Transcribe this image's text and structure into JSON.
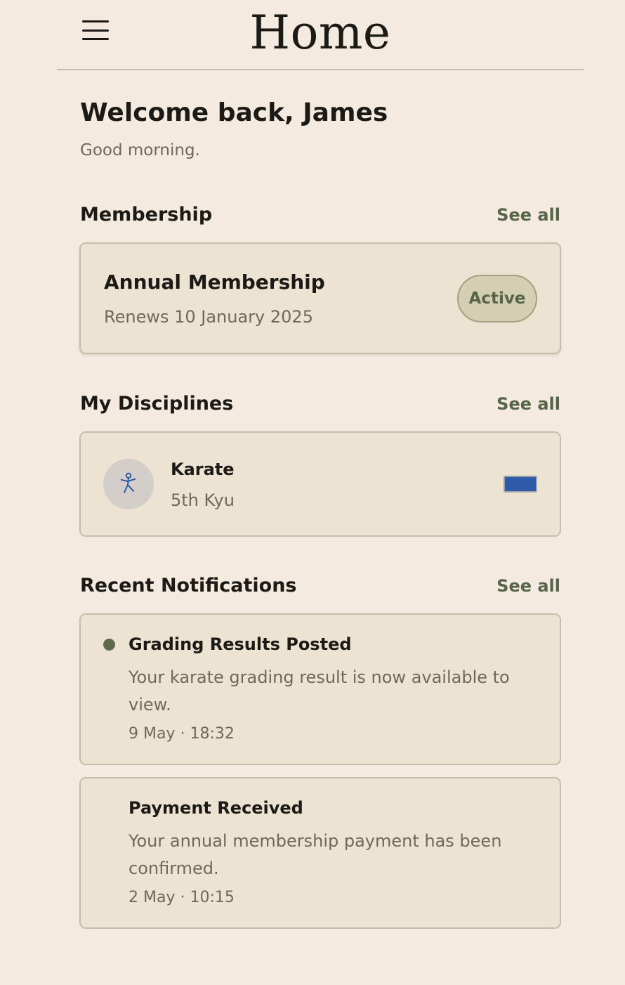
{
  "header": {
    "title": "Home",
    "menu_icon": "hamburger-menu-icon"
  },
  "welcome": {
    "heading": "Welcome back, James",
    "greeting": "Good morning."
  },
  "membership": {
    "section_title": "Membership",
    "see_all": "See all",
    "plan_name": "Annual Membership",
    "renewal": "Renews 10 January 2025",
    "status": "Active"
  },
  "disciplines": {
    "section_title": "My Disciplines",
    "see_all": "See all",
    "items": [
      {
        "name": "Karate",
        "rank": "5th Kyu",
        "icon": "karate-figure-icon",
        "belt_color": "#2f5aa8"
      }
    ]
  },
  "notifications": {
    "section_title": "Recent Notifications",
    "see_all": "See all",
    "items": [
      {
        "title": "Grading Results Posted",
        "body": "Your karate grading result is now available to view.",
        "time": "9 May · 18:32",
        "unread": true
      },
      {
        "title": "Payment Received",
        "body": "Your annual membership payment has been confirmed.",
        "time": "2 May · 10:15",
        "unread": false
      }
    ]
  },
  "colors": {
    "background": "#f4eadf",
    "card": "#ece3d2",
    "accent": "#566448",
    "text": "#1c1a16",
    "muted": "#6f685c"
  }
}
